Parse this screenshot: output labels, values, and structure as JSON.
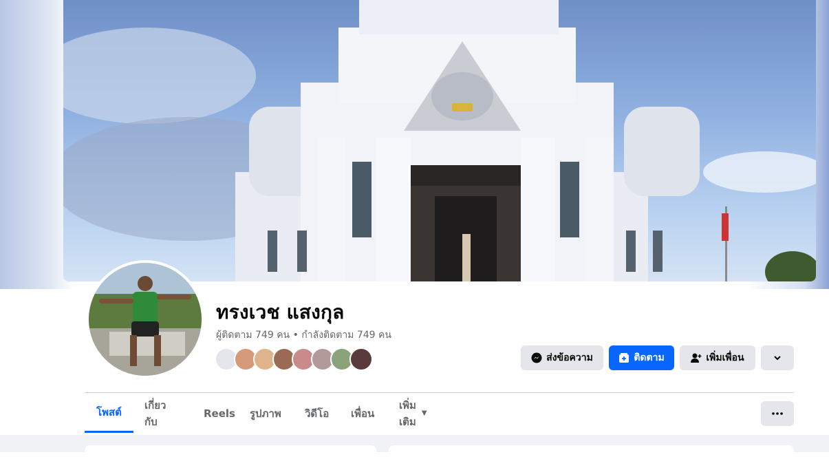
{
  "profile": {
    "name": "ทรงเวช แสงกุล",
    "followers_text": "ผู้ติดตาม 749 คน • กำลังติดตาม 749 คน"
  },
  "actions": {
    "message_label": "ส่งข้อความ",
    "follow_label": "ติดตาม",
    "add_friend_label": "เพิ่มเพื่อน"
  },
  "tabs": [
    {
      "label": "โพสต์",
      "active": true
    },
    {
      "label": "เกี่ยวกับ"
    },
    {
      "label": "Reels"
    },
    {
      "label": "รูปภาพ"
    },
    {
      "label": "วิดีโอ"
    },
    {
      "label": "เพื่อน"
    },
    {
      "label": "เพิ่มเติม"
    }
  ],
  "icons": {
    "messenger": "messenger-icon",
    "follow": "follow-icon",
    "add_friend": "add-friend-icon",
    "chevron": "chevron-down-icon",
    "more": "more-dots-icon"
  },
  "colors": {
    "accent": "#0866ff",
    "button_gray": "#e4e6eb",
    "secondary_text": "#65676b"
  }
}
